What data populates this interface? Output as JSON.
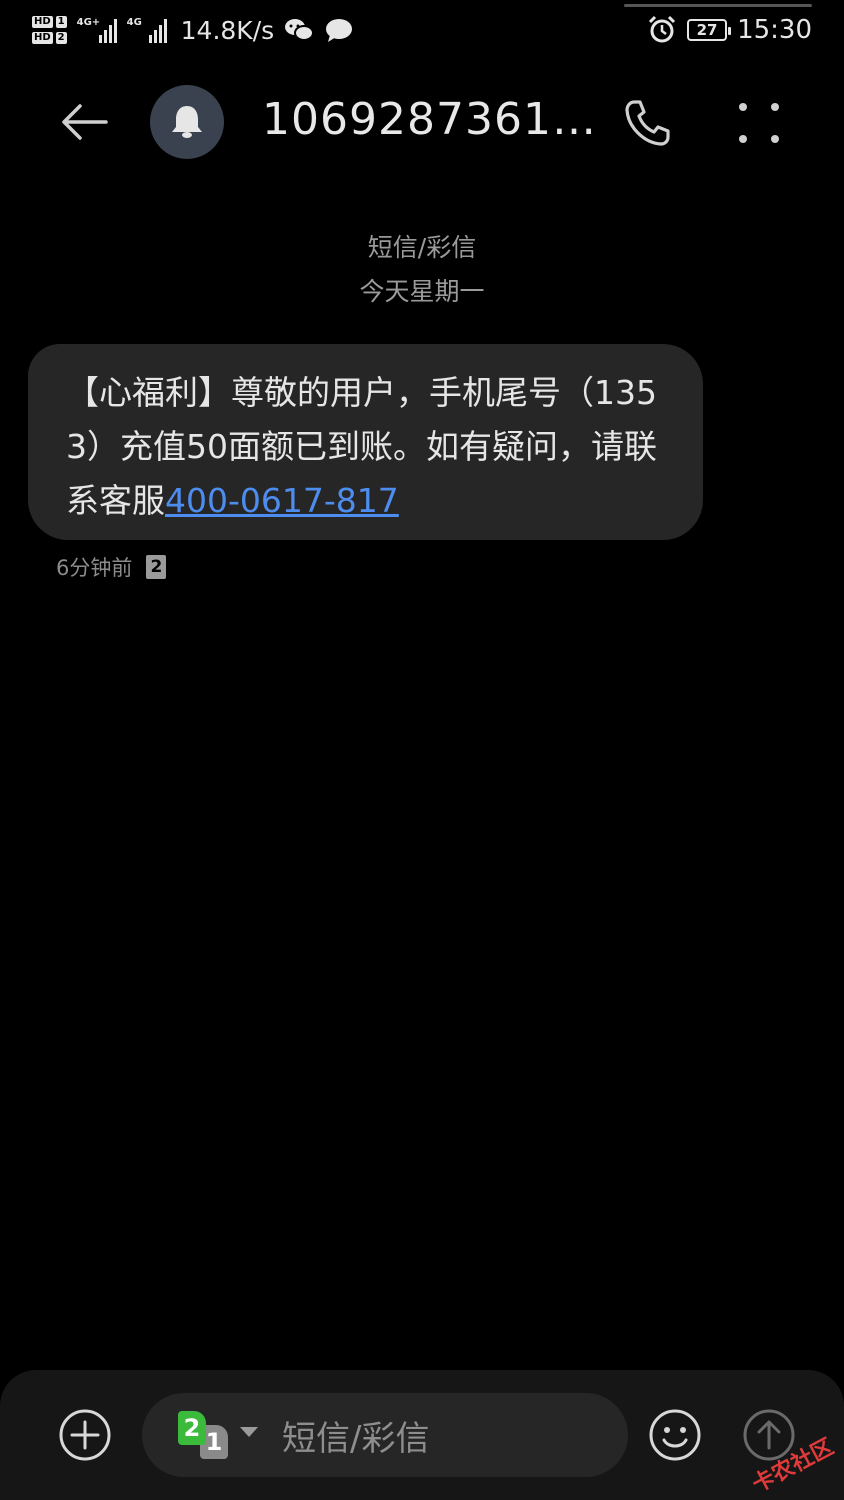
{
  "status_bar": {
    "sim1_hd": "HD",
    "sim1_num": "1",
    "sim2_hd": "HD",
    "sim2_num": "2",
    "net1_label": "4G+",
    "net2_label": "4G",
    "speed": "14.8K/s",
    "battery": "27",
    "time": "15:30",
    "icons": [
      "wechat-icon",
      "chat-bubble-icon",
      "alarm-icon",
      "battery-icon"
    ]
  },
  "header": {
    "title": "1069287361…",
    "icons": [
      "back-arrow-icon",
      "bell-icon",
      "phone-icon",
      "more-dots-icon"
    ]
  },
  "conversation": {
    "type_label": "短信/彩信",
    "date_label": "今天星期一",
    "messages": [
      {
        "text": "【心福利】尊敬的用户，手机尾号（1353）充值50面额已到账。如有疑问，请联系客服",
        "link": "400-0617-817",
        "time": "6分钟前",
        "sim": "2"
      }
    ]
  },
  "input_bar": {
    "placeholder": "短信/彩信",
    "sim_front": "2",
    "sim_back": "1",
    "icons": [
      "add-icon",
      "sim-switch-icon",
      "emoji-icon",
      "send-icon"
    ]
  },
  "watermark": "卡农社区",
  "colors": {
    "background": "#000000",
    "bubble": "#262626",
    "link": "#4e8df0",
    "avatar": "#3a4250",
    "sim_green": "#3cba3c"
  }
}
